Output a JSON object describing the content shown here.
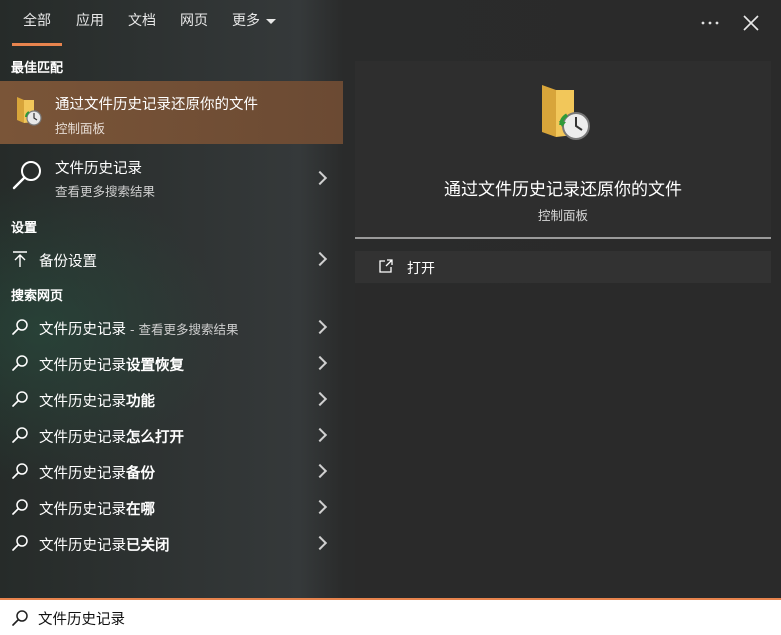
{
  "tabs": [
    {
      "label": "全部",
      "active": true
    },
    {
      "label": "应用"
    },
    {
      "label": "文档"
    },
    {
      "label": "网页"
    },
    {
      "label": "更多"
    }
  ],
  "top_actions": {
    "more_icon": "ellipsis-icon",
    "close_icon": "close-icon"
  },
  "sections": {
    "best_match": "最佳匹配",
    "settings": "设置",
    "web": "搜索网页"
  },
  "best_match": {
    "title": "通过文件历史记录还原你的文件",
    "subtitle": "控制面板",
    "icon": "folder-clock-icon"
  },
  "app_result": {
    "title": "文件历史记录",
    "subtitle": "查看更多搜索结果",
    "icon": "search-icon"
  },
  "settings_items": [
    {
      "label": "备份设置",
      "icon": "upload-arrow-icon"
    }
  ],
  "web_items": [
    {
      "prefix": "文件历史记录",
      "bold": "",
      "suffix": " - 查看更多搜索结果"
    },
    {
      "prefix": "文件历史记录",
      "bold": "设置恢复",
      "suffix": ""
    },
    {
      "prefix": "文件历史记录",
      "bold": "功能",
      "suffix": ""
    },
    {
      "prefix": "文件历史记录",
      "bold": "怎么打开",
      "suffix": ""
    },
    {
      "prefix": "文件历史记录",
      "bold": "备份",
      "suffix": ""
    },
    {
      "prefix": "文件历史记录",
      "bold": "在哪",
      "suffix": ""
    },
    {
      "prefix": "文件历史记录",
      "bold": "已关闭",
      "suffix": ""
    }
  ],
  "preview": {
    "title": "通过文件历史记录还原你的文件",
    "subtitle": "控制面板",
    "actions": [
      {
        "label": "打开",
        "icon": "open-external-icon"
      }
    ]
  },
  "search": {
    "value": "文件历史记录"
  },
  "colors": {
    "accent": "#e8844e",
    "selected_row": "#7a5538"
  }
}
